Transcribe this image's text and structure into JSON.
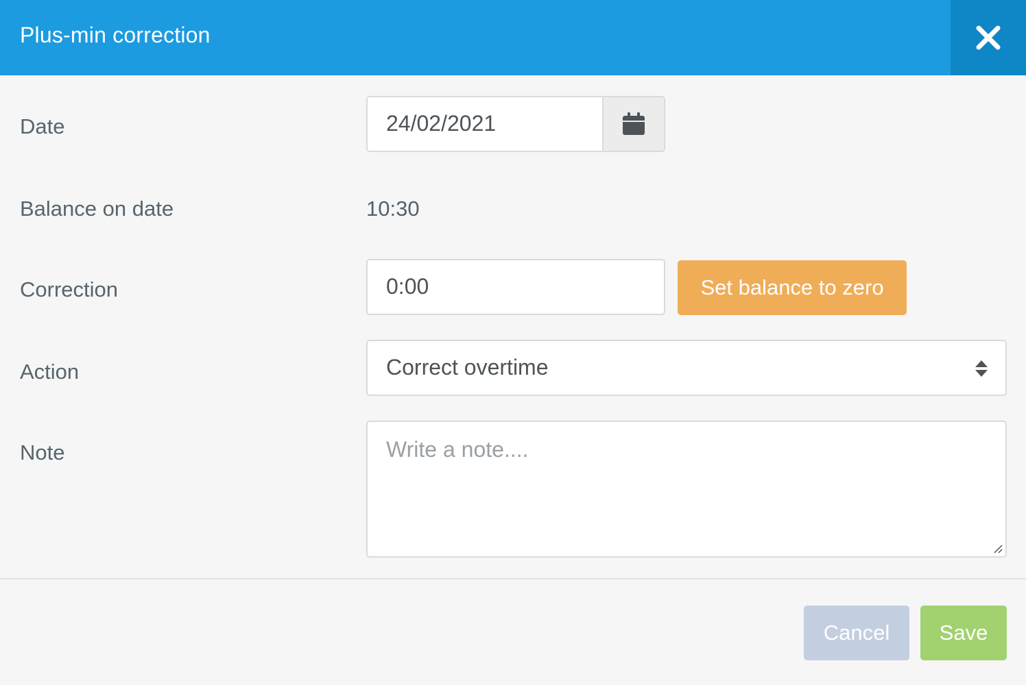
{
  "dialog": {
    "title": "Plus-min correction",
    "close_icon": "close-icon"
  },
  "form": {
    "date": {
      "label": "Date",
      "value": "24/02/2021",
      "icon": "calendar-icon"
    },
    "balance": {
      "label": "Balance on date",
      "value": "10:30"
    },
    "correction": {
      "label": "Correction",
      "value": "0:00",
      "button_label": "Set balance to zero"
    },
    "action": {
      "label": "Action",
      "selected": "Correct overtime",
      "icon": "select-arrows-icon"
    },
    "note": {
      "label": "Note",
      "placeholder": "Write a note...."
    }
  },
  "footer": {
    "cancel_label": "Cancel",
    "save_label": "Save"
  },
  "colors": {
    "header": "#1c9be0",
    "close_bg": "#0f86c6",
    "orange_button": "#f0ad57",
    "cancel_button": "#c3cfe0",
    "save_button": "#a2d270"
  }
}
